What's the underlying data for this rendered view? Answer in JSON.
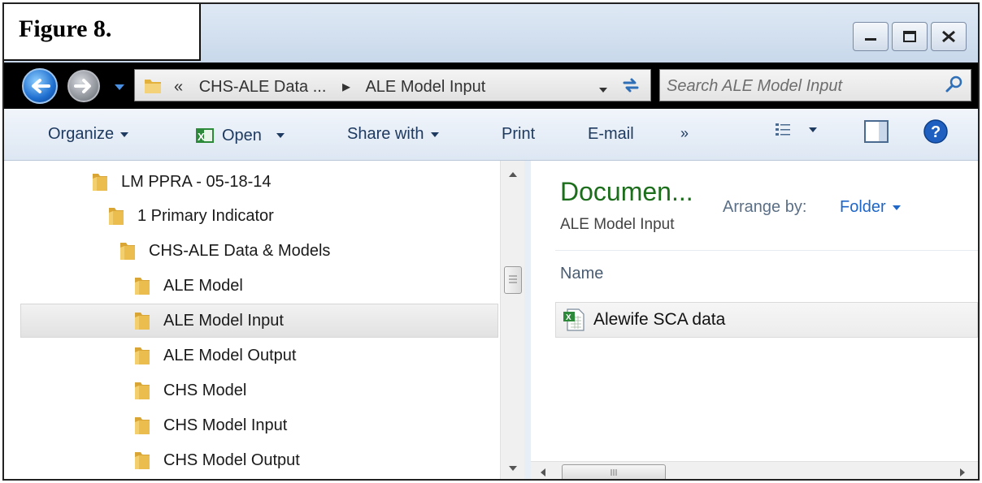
{
  "figure_label": "Figure 8.",
  "address_bar": {
    "overflow": "«",
    "crumbs": [
      "CHS-ALE Data ...",
      "ALE Model Input"
    ],
    "separator": "▸"
  },
  "search": {
    "placeholder": "Search ALE Model Input"
  },
  "toolbar": {
    "organize": "Organize",
    "open": "Open",
    "share_with": "Share with",
    "print": "Print",
    "email": "E-mail",
    "more": "»"
  },
  "nav_tree": [
    {
      "label": "LM PPRA - 05-18-14"
    },
    {
      "label": "1 Primary Indicator"
    },
    {
      "label": "CHS-ALE Data & Models"
    },
    {
      "label": "ALE Model"
    },
    {
      "label": "ALE Model Input",
      "selected": true
    },
    {
      "label": "ALE Model Output"
    },
    {
      "label": "CHS Model"
    },
    {
      "label": "CHS Model Input"
    },
    {
      "label": "CHS Model Output"
    }
  ],
  "files_pane": {
    "library_title": "Documen...",
    "library_subtitle": "ALE Model Input",
    "arrange_label": "Arrange by:",
    "arrange_value": "Folder",
    "column_name": "Name",
    "files": [
      {
        "name": "Alewife SCA data",
        "icon": "excel-file-icon"
      }
    ]
  },
  "colors": {
    "library_title": "#1c6e1c",
    "link": "#1e66c8",
    "address_bg": "#000000"
  }
}
